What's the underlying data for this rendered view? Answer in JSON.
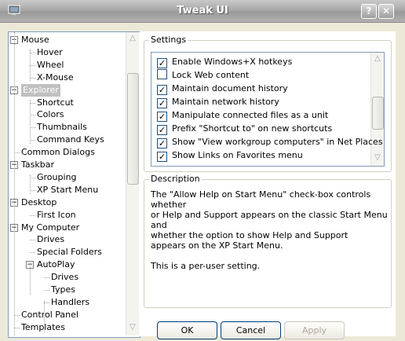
{
  "window": {
    "title": "Tweak UI"
  },
  "tree": {
    "items": [
      {
        "label": "Mouse",
        "level": 0,
        "expander": "minus"
      },
      {
        "label": "Hover",
        "level": 1
      },
      {
        "label": "Wheel",
        "level": 1
      },
      {
        "label": "X-Mouse",
        "level": 1
      },
      {
        "label": "Explorer",
        "level": 0,
        "expander": "minus",
        "selected": true
      },
      {
        "label": "Shortcut",
        "level": 1
      },
      {
        "label": "Colors",
        "level": 1
      },
      {
        "label": "Thumbnails",
        "level": 1
      },
      {
        "label": "Command Keys",
        "level": 1
      },
      {
        "label": "Common Dialogs",
        "level": 0
      },
      {
        "label": "Taskbar",
        "level": 0,
        "expander": "minus"
      },
      {
        "label": "Grouping",
        "level": 1
      },
      {
        "label": "XP Start Menu",
        "level": 1
      },
      {
        "label": "Desktop",
        "level": 0,
        "expander": "minus"
      },
      {
        "label": "First Icon",
        "level": 1
      },
      {
        "label": "My Computer",
        "level": 0,
        "expander": "minus"
      },
      {
        "label": "Drives",
        "level": 1
      },
      {
        "label": "Special Folders",
        "level": 1
      },
      {
        "label": "AutoPlay",
        "level": 1,
        "expander": "minus"
      },
      {
        "label": "Drives",
        "level": 2
      },
      {
        "label": "Types",
        "level": 2
      },
      {
        "label": "Handlers",
        "level": 2
      },
      {
        "label": "Control Panel",
        "level": 0
      },
      {
        "label": "Templates",
        "level": 0
      }
    ]
  },
  "settings": {
    "title": "Settings",
    "items": [
      {
        "label": "Enable Windows+X hotkeys",
        "checked": true
      },
      {
        "label": "Lock Web content",
        "checked": false
      },
      {
        "label": "Maintain document history",
        "checked": true
      },
      {
        "label": "Maintain network history",
        "checked": true
      },
      {
        "label": "Manipulate connected files as a unit",
        "checked": true
      },
      {
        "label": "Prefix \"Shortcut to\" on new shortcuts",
        "checked": true
      },
      {
        "label": "Show \"View workgroup computers\" in Net Places",
        "checked": true
      },
      {
        "label": "Show Links on Favorites menu",
        "checked": true
      }
    ]
  },
  "description": {
    "title": "Description",
    "line1": "The \"Allow Help on Start Menu\" check-box controls whether",
    "line2": "or Help and Support appears on the classic Start Menu and",
    "line3": "whether the option to show Help and Support",
    "line4": "appears on the XP Start Menu.",
    "line5": "This is a per-user setting."
  },
  "buttons": {
    "ok": "OK",
    "cancel": "Cancel",
    "apply": "Apply"
  },
  "colors": {
    "selection": "#c0c0c0",
    "border": "#7f9db9",
    "dialog_bg": "#ece9d8"
  }
}
